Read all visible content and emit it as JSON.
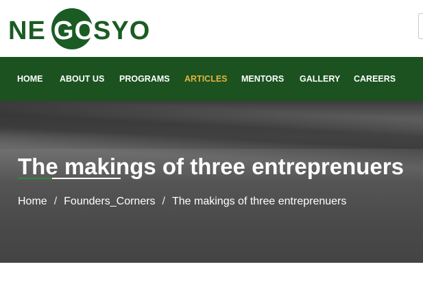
{
  "brand": {
    "logo_part1": "NE",
    "logo_part2": "GO",
    "logo_part3": "SYO",
    "logo_color": "#1a5c23"
  },
  "nav": {
    "items": [
      {
        "label": "HOME"
      },
      {
        "label": "ABOUT US"
      },
      {
        "label": "PROGRAMS"
      },
      {
        "label": "ARTICLES",
        "active": true
      },
      {
        "label": "MENTORS"
      },
      {
        "label": "GALLERY"
      },
      {
        "label": "CAREERS"
      }
    ],
    "bg_color": "#1b5220",
    "active_color": "#e1b442"
  },
  "hero": {
    "title": "The makings of three entreprenuers",
    "breadcrumb": {
      "home": "Home",
      "category": "Founders_Corners",
      "current": "The makings of three entreprenuers",
      "separator": "/"
    }
  }
}
